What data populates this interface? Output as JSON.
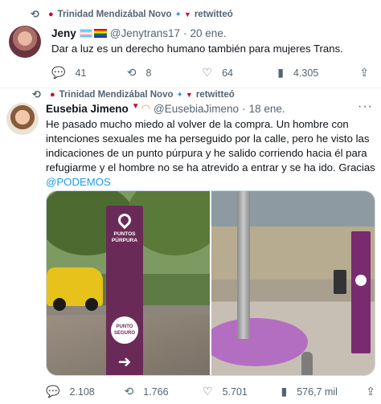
{
  "tweet1": {
    "retweet_line": "Trinidad Mendizábal Novo",
    "retweet_suffix": "retwitteó",
    "name": "Jeny",
    "handle": "@Jenytrans17",
    "date": "20 ene.",
    "text": "Dar a luz es un derecho humano también para mujeres Trans.",
    "replies": "41",
    "retweets": "8",
    "likes": "64",
    "views": "4.305"
  },
  "tweet2": {
    "retweet_line": "Trinidad Mendizábal Novo",
    "retweet_suffix": "retwitteó",
    "name": "Eusebia Jimeno",
    "handle": "@EusebiaJimeno",
    "date": "18 ene.",
    "text": "He pasado mucho miedo al volver de la compra. Un hombre con intenciones sexuales me ha perseguido por la calle, pero he visto las indicaciones de un punto púrpura y he salido corriendo hacia él para refugiarme y el hombre no se ha atrevido a entrar y se ha ido. Gracias",
    "mention": "@PODEMOS",
    "replies": "2.108",
    "retweets": "1.766",
    "likes": "5.701",
    "views": "576,7 mil",
    "media": {
      "post_label": "PUNTOS PÚRPURA",
      "sign_label": "PUNTO SEGURO"
    }
  },
  "icons": {
    "retweet": "retweet-icon",
    "reply": "reply-icon",
    "like": "heart-icon",
    "views": "bar-chart-icon",
    "share": "share-icon",
    "more": "more-icon"
  }
}
